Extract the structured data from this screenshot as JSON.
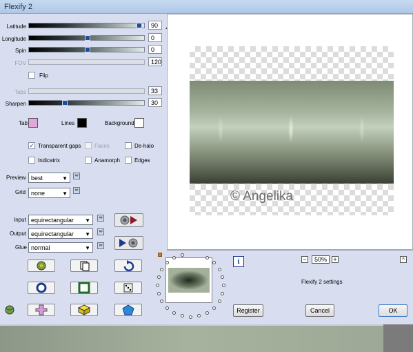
{
  "window": {
    "title": "Flexify 2"
  },
  "sliders": [
    {
      "label": "Latitude",
      "value": "90",
      "fraction": 0.97
    },
    {
      "label": "Longitude",
      "value": "0",
      "fraction": 0.5
    },
    {
      "label": "Spin",
      "value": "0",
      "fraction": 0.5
    },
    {
      "label": "FOV",
      "value": "120",
      "disabled": true
    },
    {
      "label": "Tabs",
      "value": "33",
      "disabled": true
    },
    {
      "label": "Sharpen",
      "value": "30",
      "fraction": 0.3
    }
  ],
  "flip": {
    "label": "Flip",
    "checked": false
  },
  "colors": {
    "tab_label": "Tab",
    "tab_color": "#e2a6de",
    "lines_label": "Lines",
    "lines_color": "#000000",
    "background_label": "Background",
    "background_color": "#ffffff"
  },
  "options": {
    "transparent_gaps": {
      "label": "Transparent gaps",
      "checked": true
    },
    "faces": {
      "label": "Faces",
      "checked": false,
      "disabled": true
    },
    "de_halo": {
      "label": "De-halo",
      "checked": false
    },
    "indicatrix": {
      "label": "Indicatrix",
      "checked": false
    },
    "anamorph": {
      "label": "Anamorph",
      "checked": false
    },
    "edges": {
      "label": "Edges",
      "checked": false
    }
  },
  "preview_select": {
    "label": "Preview",
    "value": "best"
  },
  "grid_select": {
    "label": "Grid",
    "value": "none"
  },
  "input_select": {
    "label": "Input",
    "value": "equirectangular"
  },
  "output_select": {
    "label": "Output",
    "value": "equirectangular"
  },
  "glue_select": {
    "label": "Glue",
    "value": "normal"
  },
  "zoom": {
    "value": "50%",
    "minus": "−",
    "plus": "+"
  },
  "settings_text": "Flexify 2 settings",
  "buttons": {
    "register": "Register",
    "cancel": "Cancel",
    "ok": "OK",
    "collapse": "^"
  },
  "watermark": "© Angelika",
  "info_icon": "i"
}
